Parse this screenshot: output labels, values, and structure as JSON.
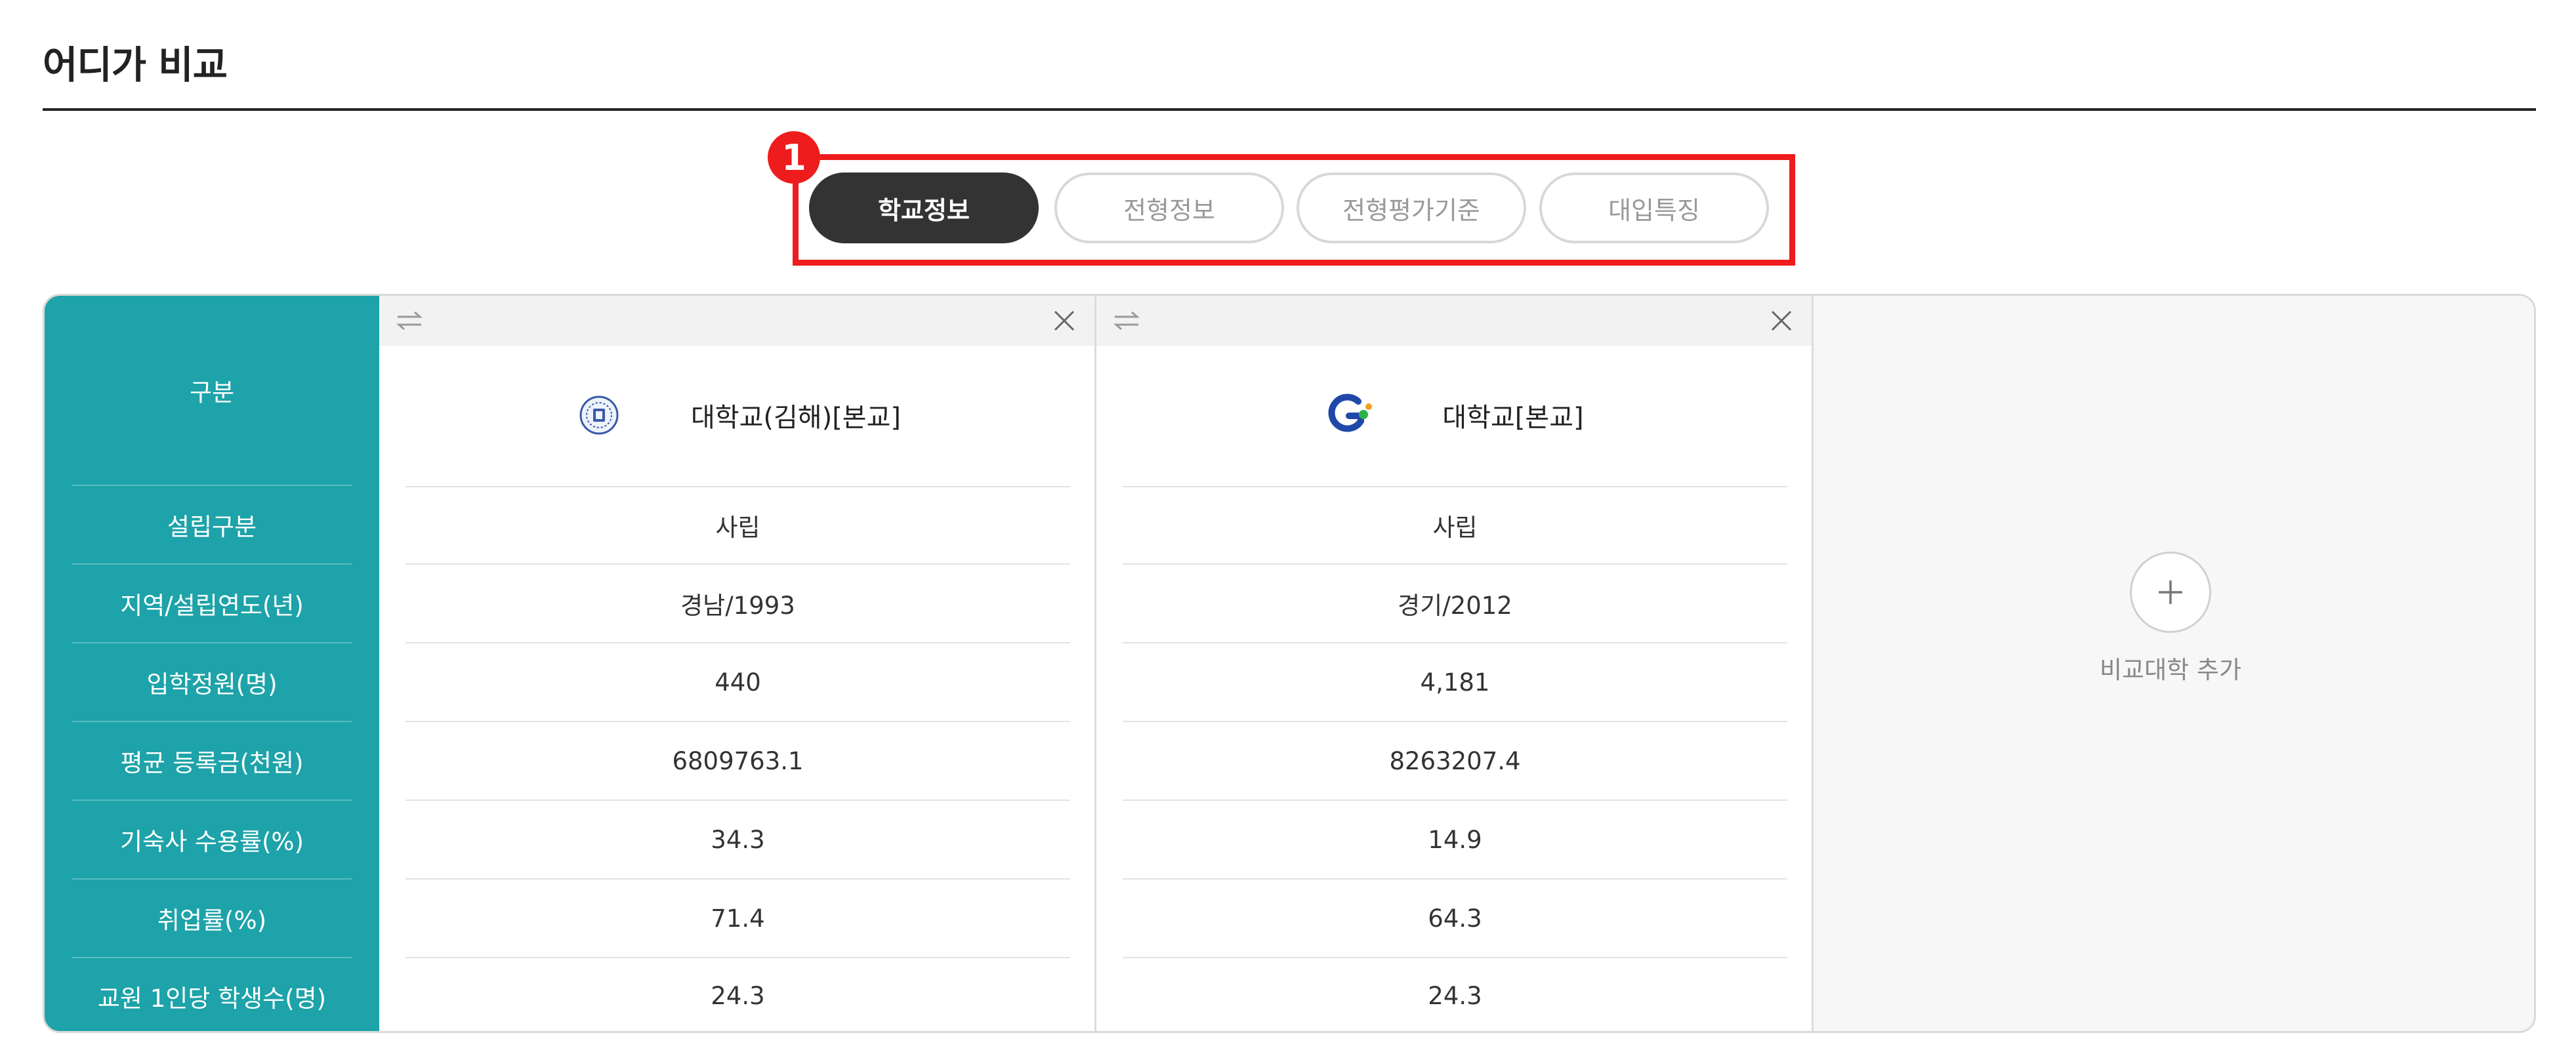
{
  "page": {
    "title": "어디가 비교"
  },
  "tabs": {
    "step_badge": "1",
    "items": [
      {
        "label": "학교정보",
        "active": true
      },
      {
        "label": "전형정보",
        "active": false
      },
      {
        "label": "전형평가기준",
        "active": false
      },
      {
        "label": "대입특징",
        "active": false
      }
    ]
  },
  "table": {
    "header_label": "구분",
    "row_labels": [
      "설립구분",
      "지역/설립연도(년)",
      "입학정원(명)",
      "평균 등록금(천원)",
      "기숙사 수용률(%)",
      "취업률(%)",
      "교원 1인당 학생수(명)"
    ],
    "universities": [
      {
        "name": "대학교(김해)[본교]",
        "logo_icon": "university-seal-icon",
        "values": [
          "사립",
          "경남/1993",
          "440",
          "6809763.1",
          "34.3",
          "71.4",
          "24.3"
        ]
      },
      {
        "name": "대학교[본교]",
        "logo_icon": "g-logo-icon",
        "values": [
          "사립",
          "경기/2012",
          "4,181",
          "8263207.4",
          "14.9",
          "64.3",
          "24.3"
        ]
      }
    ],
    "add": {
      "label": "비교대학 추가"
    }
  },
  "colors": {
    "accent_teal": "#1da3a9",
    "highlight_red": "#ee1c1c",
    "active_tab": "#333333"
  }
}
